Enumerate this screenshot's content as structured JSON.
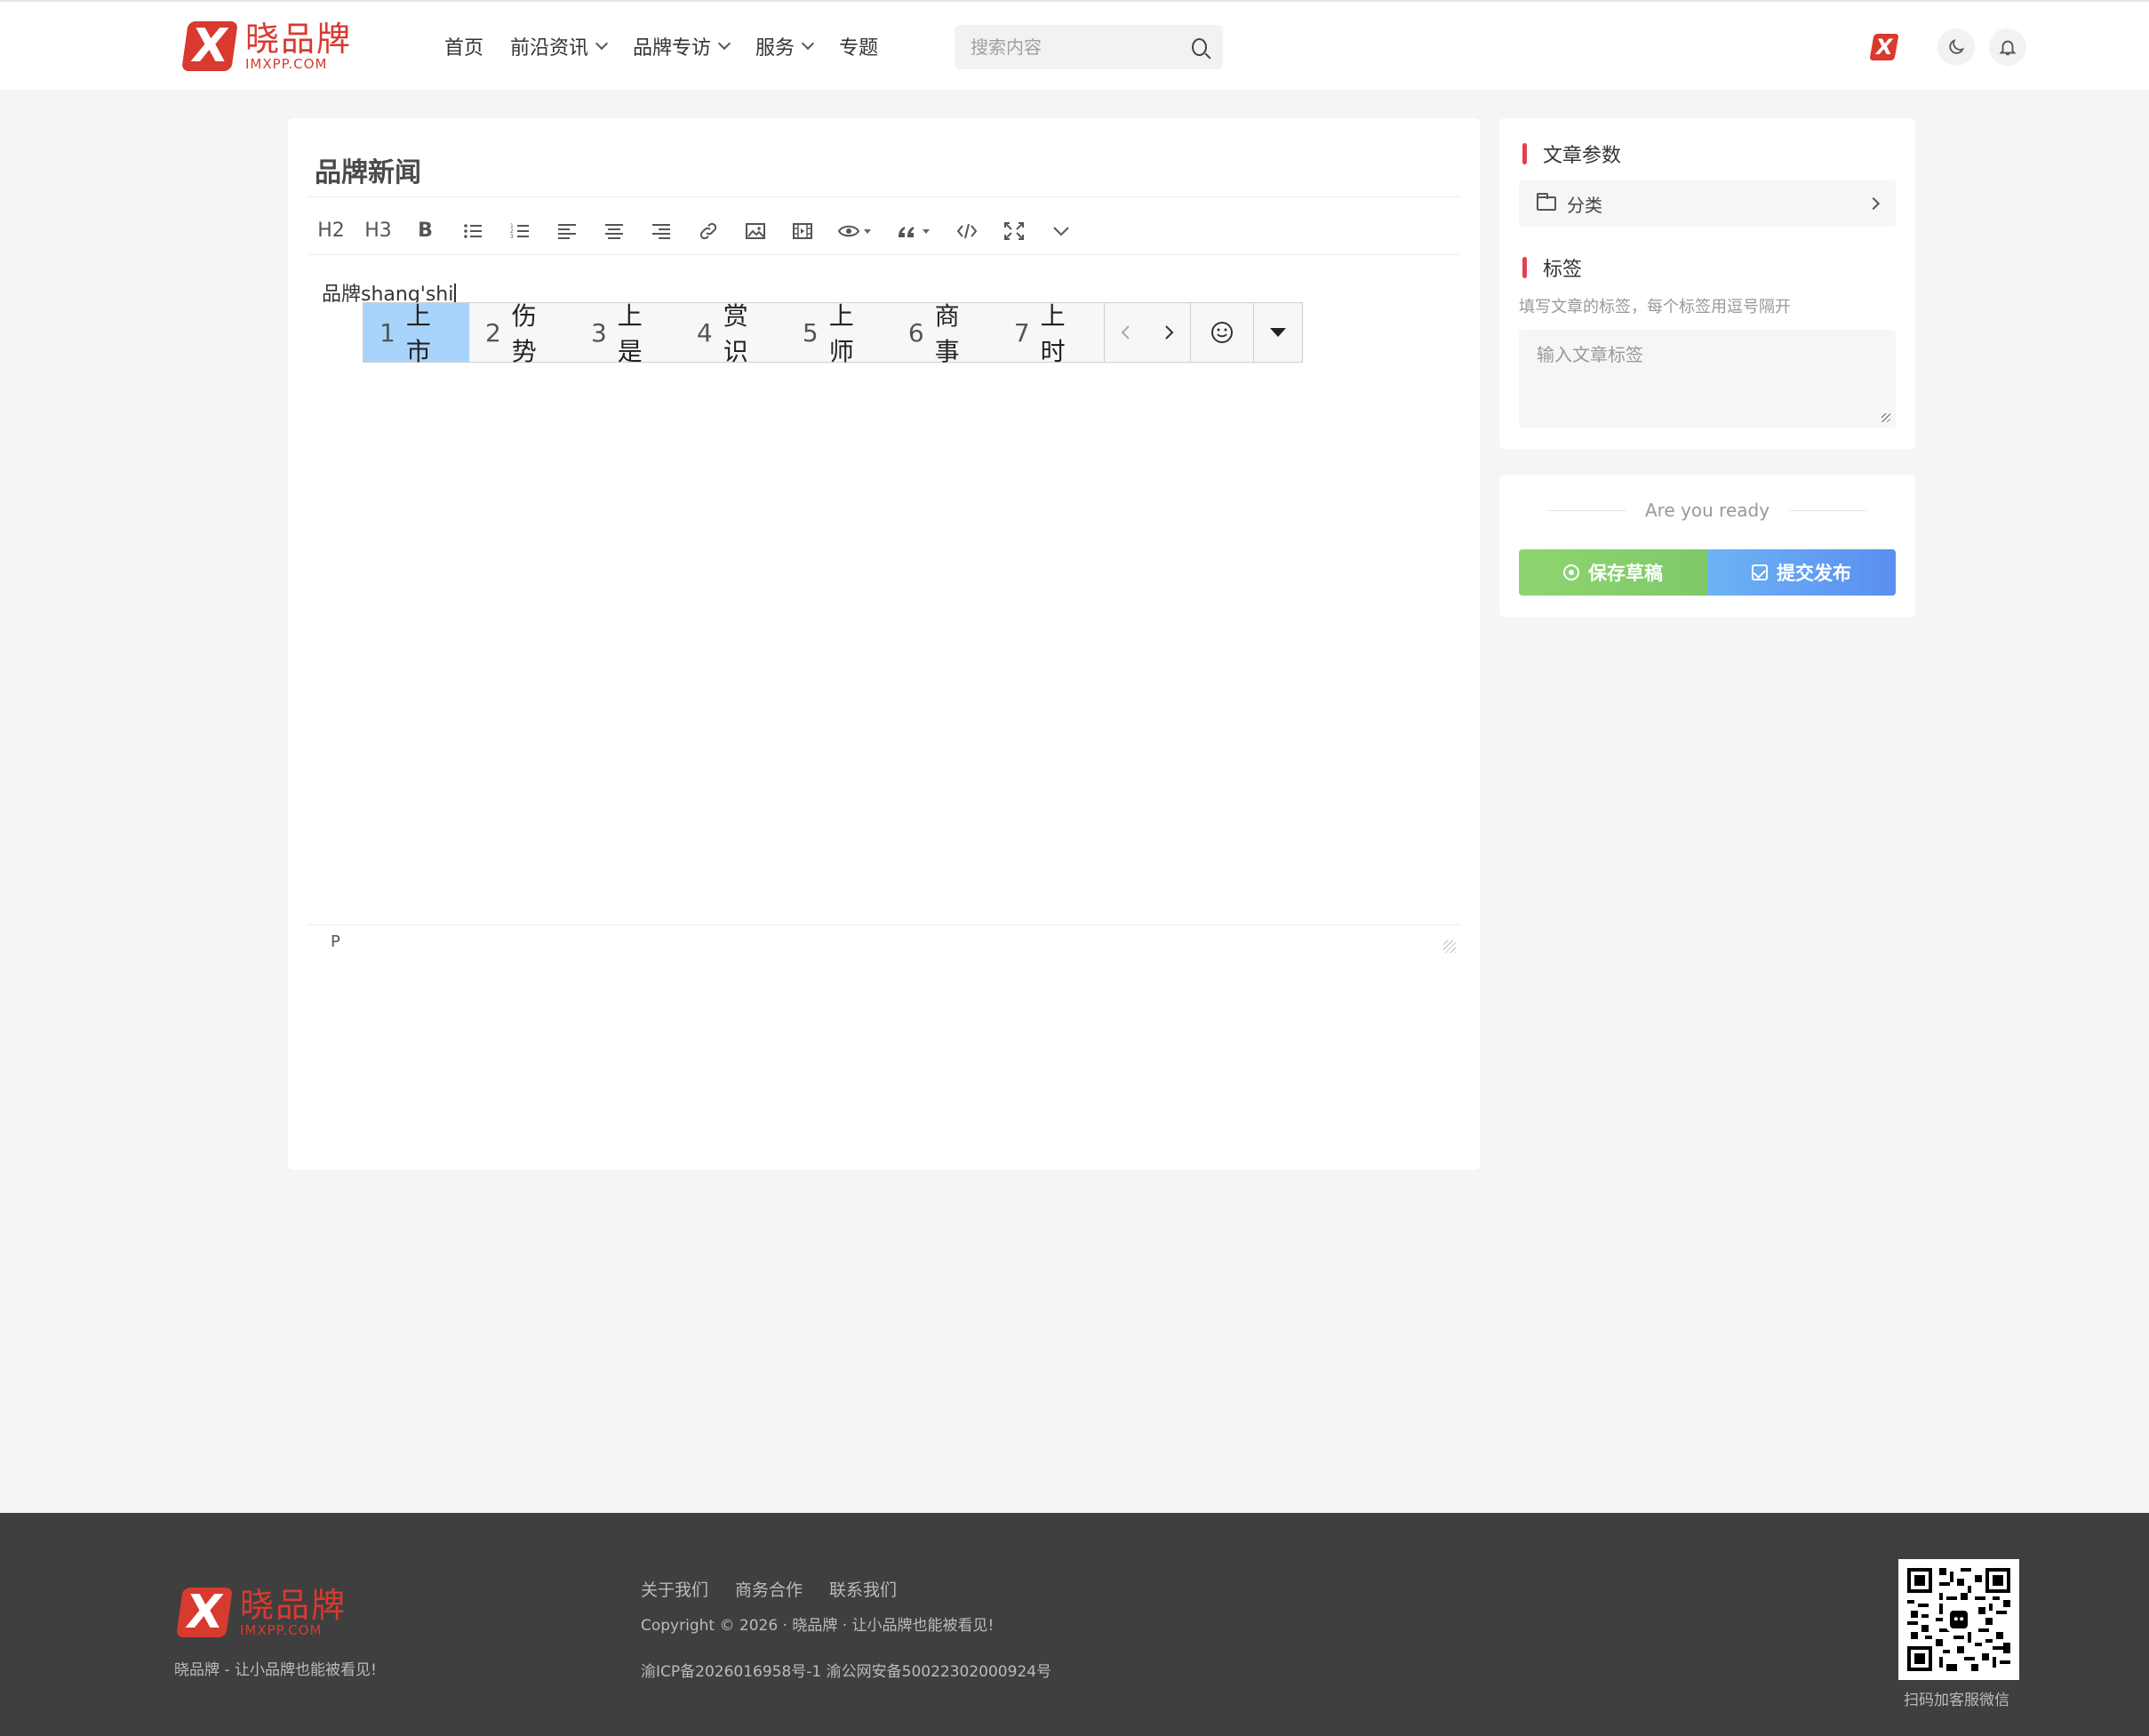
{
  "header": {
    "logo_cn": "晓品牌",
    "logo_en": "IMXPP.COM",
    "nav": [
      {
        "label": "首页",
        "dropdown": false
      },
      {
        "label": "前沿资讯",
        "dropdown": true
      },
      {
        "label": "品牌专访",
        "dropdown": true
      },
      {
        "label": "服务",
        "dropdown": true
      },
      {
        "label": "专题",
        "dropdown": false
      }
    ],
    "search_placeholder": "搜索内容"
  },
  "editor": {
    "title": "品牌新闻",
    "toolbar": [
      "H2",
      "H3",
      "B",
      "bullet-list-icon",
      "ordered-list-icon",
      "align-left-icon",
      "align-center-icon",
      "align-right-icon",
      "link-icon",
      "image-icon",
      "video-icon",
      "preview-icon",
      "quote-icon",
      "code-icon",
      "fullscreen-icon",
      "more-icon"
    ],
    "content_text": "品牌shang'shi",
    "status_path": "P"
  },
  "ime": {
    "candidates": [
      {
        "num": "1",
        "text": "上市",
        "active": true
      },
      {
        "num": "2",
        "text": "伤势",
        "active": false
      },
      {
        "num": "3",
        "text": "上是",
        "active": false
      },
      {
        "num": "4",
        "text": "赏识",
        "active": false
      },
      {
        "num": "5",
        "text": "上师",
        "active": false
      },
      {
        "num": "6",
        "text": "商事",
        "active": false
      },
      {
        "num": "7",
        "text": "上时",
        "active": false
      }
    ]
  },
  "sidebar": {
    "params_title": "文章参数",
    "category_label": "分类",
    "tags_title": "标签",
    "tags_hint": "填写文章的标签，每个标签用逗号隔开",
    "tags_placeholder": "输入文章标签",
    "ready_text": "Are you ready",
    "save_label": "保存草稿",
    "publish_label": "提交发布"
  },
  "footer": {
    "logo_cn": "晓品牌",
    "logo_en": "IMXPP.COM",
    "slogan": "晓品牌 - 让小品牌也能被看见!",
    "links": [
      "关于我们",
      "商务合作",
      "联系我们"
    ],
    "copyright": "Copyright © 2026 · 晓品牌 · 让小品牌也能被看见!",
    "icp": "渝ICP备2026016958号-1 渝公网安备50022302000924号",
    "qr_caption": "扫码加客服微信"
  },
  "colors": {
    "brand": "#d83a2f",
    "accent_bar": "#e5404f",
    "draft_green": "#8fd56f",
    "publish_blue": "#5b8ef0",
    "ime_highlight": "#a8d4fb"
  }
}
